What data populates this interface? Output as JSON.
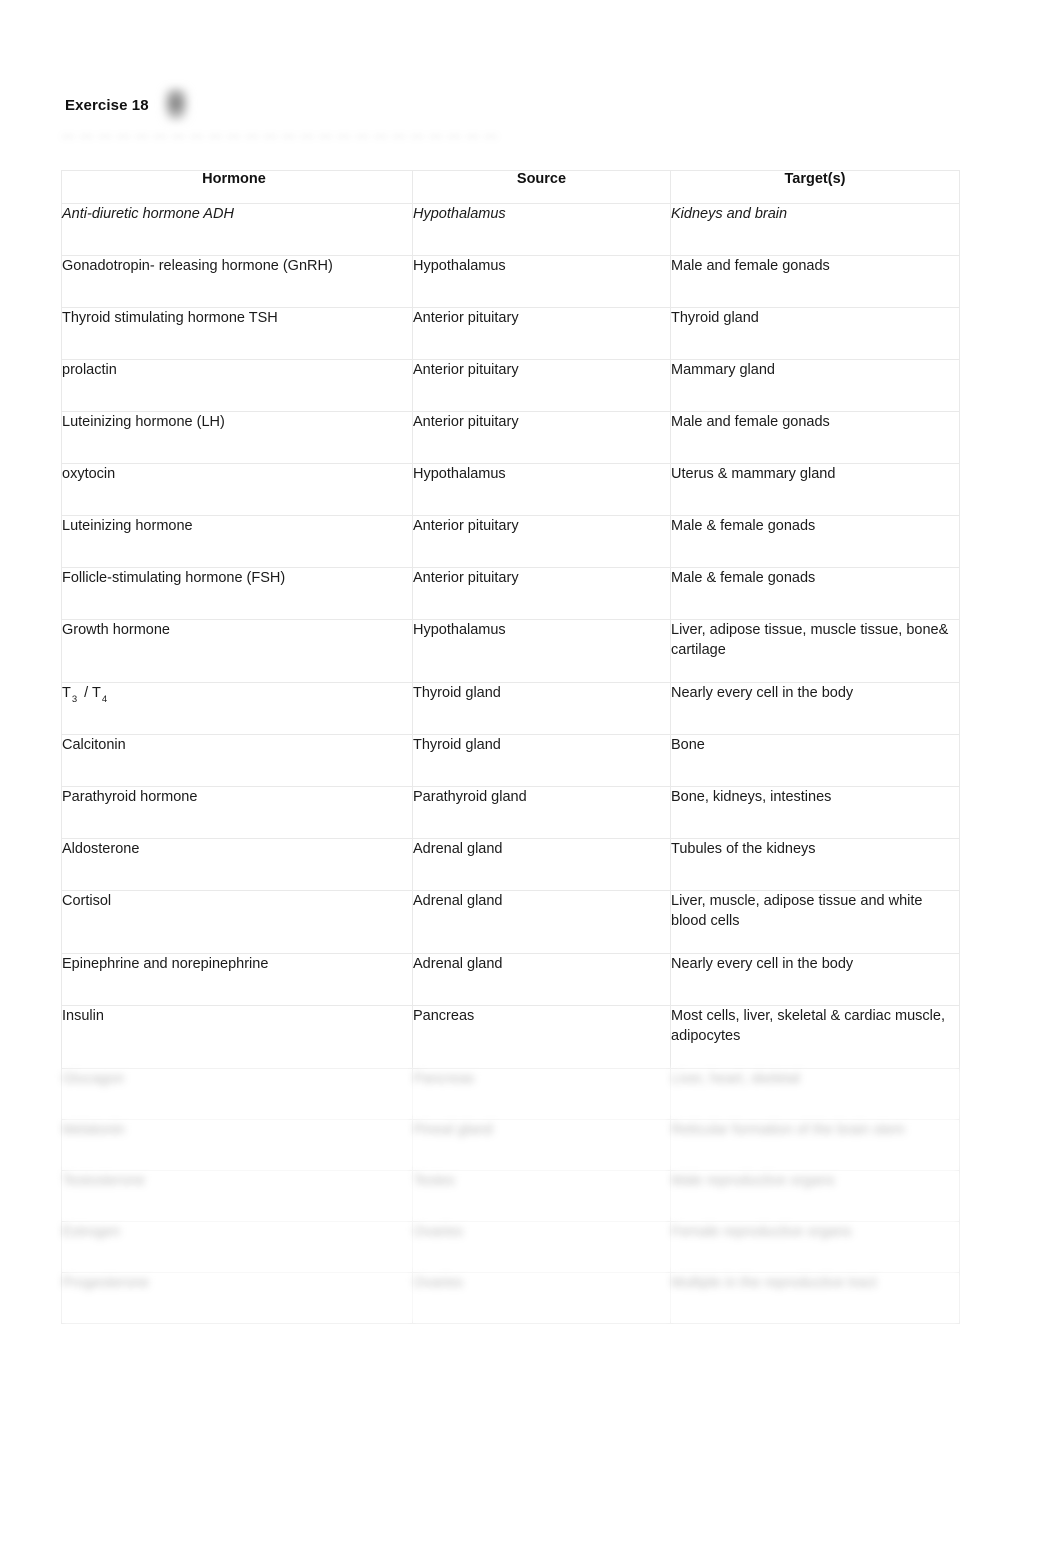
{
  "document": {
    "exercise_label": "Exercise 18",
    "redacted_header_mark": "redacted-image",
    "obscured_line_text": "—  —  —  —  —  —  —  —  —  —  —  —  —  —  —  —  —  —  —  —  —  —  —  —"
  },
  "table": {
    "columns": [
      "Hormone",
      "Source",
      "Target(s)"
    ],
    "rows": [
      {
        "hormone": "Anti-diuretic hormone ADH",
        "source": "Hypothalamus",
        "target": "Kidneys and brain",
        "style": "italic",
        "obscured": false
      },
      {
        "hormone": "Gonadotropin-  releasing hormone (GnRH)",
        "source": "Hypothalamus",
        "target": "Male and female gonads",
        "style": "normal",
        "obscured": false
      },
      {
        "hormone": "Thyroid stimulating hormone TSH",
        "source": "Anterior pituitary",
        "target": "Thyroid gland",
        "style": "normal",
        "obscured": false
      },
      {
        "hormone": "prolactin",
        "source": "Anterior pituitary",
        "target": "Mammary gland",
        "style": "normal",
        "obscured": false
      },
      {
        "hormone": "Luteinizing hormone (LH)",
        "source": "Anterior pituitary",
        "target": "Male and female gonads",
        "style": "normal",
        "obscured": false
      },
      {
        "hormone": "oxytocin",
        "source": "Hypothalamus",
        "target": "Uterus & mammary gland",
        "style": "normal",
        "obscured": false
      },
      {
        "hormone": "Luteinizing  hormone",
        "source": "Anterior pituitary",
        "target": "Male & female gonads",
        "style": "normal",
        "obscured": false
      },
      {
        "hormone": "Follicle-stimulating hormone (FSH)",
        "source": "Anterior pituitary",
        "target": "Male & female gonads",
        "style": "normal",
        "obscured": false
      },
      {
        "hormone": "Growth hormone",
        "source": "Hypothalamus",
        "target": "Liver, adipose tissue, muscle tissue, bone& cartilage",
        "style": "normal",
        "obscured": false
      },
      {
        "hormone": "T3 / T4",
        "hormone_parts": {
          "base1": "T",
          "sub1": "3",
          "sep": " / ",
          "base2": "T",
          "sub2": "4"
        },
        "source": "Thyroid gland",
        "target": "Nearly every cell in the body",
        "style": "normal",
        "obscured": false
      },
      {
        "hormone": "Calcitonin",
        "source": "Thyroid gland",
        "target": "Bone",
        "style": "normal",
        "obscured": false
      },
      {
        "hormone": "Parathyroid  hormone",
        "source": "Parathyroid gland",
        "target": "Bone, kidneys, intestines",
        "style": "normal",
        "obscured": false
      },
      {
        "hormone": "Aldosterone",
        "source": "Adrenal gland",
        "target": "Tubules of the kidneys",
        "style": "normal",
        "obscured": false
      },
      {
        "hormone": "Cortisol",
        "source": "Adrenal gland",
        "target": "Liver, muscle, adipose tissue and white blood cells",
        "style": "normal",
        "obscured": false
      },
      {
        "hormone": "Epinephrine  and  norepinephrine",
        "source": "Adrenal gland",
        "target": "Nearly every cell in the body",
        "style": "normal",
        "obscured": false
      },
      {
        "hormone": "Insulin",
        "source": "Pancreas",
        "target": "Most cells, liver, skeletal & cardiac muscle, adipocytes",
        "style": "normal",
        "obscured": false
      },
      {
        "hormone": "Glucagon",
        "source": "Pancreas",
        "target": "Liver, heart, skeletal",
        "style": "normal",
        "obscured": true
      },
      {
        "hormone": "Melatonin",
        "source": "Pineal gland",
        "target": "Reticular formation of the brain stem",
        "style": "normal",
        "obscured": true
      },
      {
        "hormone": "Testosterone",
        "source": "Testes",
        "target": "Male reproductive organs",
        "style": "normal",
        "obscured": true
      },
      {
        "hormone": "Estrogen",
        "source": "Ovaries",
        "target": "Female reproductive organs",
        "style": "normal",
        "obscured": true
      },
      {
        "hormone": "Progesterone",
        "source": "Ovaries",
        "target": "Multiple in the reproductive tract",
        "style": "normal",
        "obscured": true
      }
    ]
  }
}
